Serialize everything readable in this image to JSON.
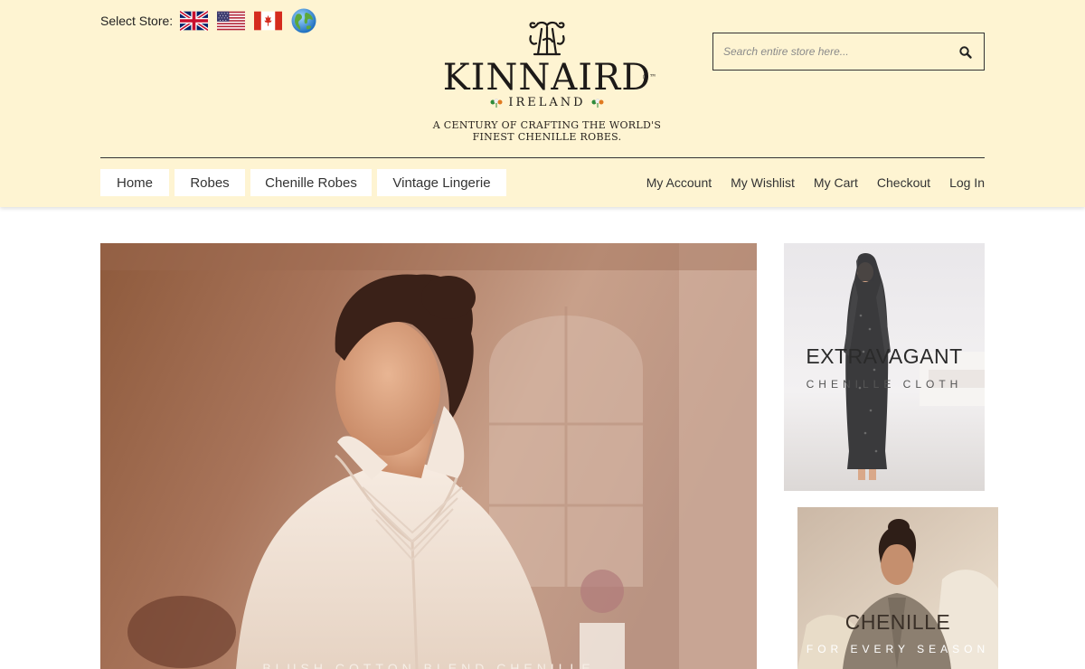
{
  "header": {
    "store_label": "Select Store:",
    "stores": [
      {
        "name": "uk-flag-icon"
      },
      {
        "name": "us-flag-icon"
      },
      {
        "name": "canada-flag-icon"
      },
      {
        "name": "globe-icon"
      }
    ],
    "logo": {
      "name": "KINNAIRD",
      "trademark": "®™",
      "sub": "IRELAND",
      "tagline_line1": "A CENTURY OF CRAFTING THE WORLD'S",
      "tagline_line2": "FINEST CHENILLE ROBES."
    },
    "search": {
      "placeholder": "Search entire store here...",
      "value": "",
      "icon": "search-icon"
    }
  },
  "nav": {
    "items": [
      {
        "label": "Home"
      },
      {
        "label": "Robes"
      },
      {
        "label": "Chenille Robes"
      },
      {
        "label": "Vintage Lingerie"
      }
    ]
  },
  "account_links": [
    {
      "label": "My Account"
    },
    {
      "label": "My Wishlist"
    },
    {
      "label": "My Cart"
    },
    {
      "label": "Checkout"
    },
    {
      "label": "Log In"
    }
  ],
  "hero": {
    "caption": "BLUSH COTTON BLEND CHENILLE"
  },
  "promos": [
    {
      "title": "EXTRAVAGANT",
      "subtitle": "CHENILLE CLOTH"
    },
    {
      "title": "CHENILLE",
      "subtitle": "FOR EVERY SEASON"
    }
  ],
  "colors": {
    "header_bg": "#fef4d2",
    "text": "#333333",
    "shamrock_green": "#2e8b3a",
    "shamrock_orange": "#e07a20"
  }
}
